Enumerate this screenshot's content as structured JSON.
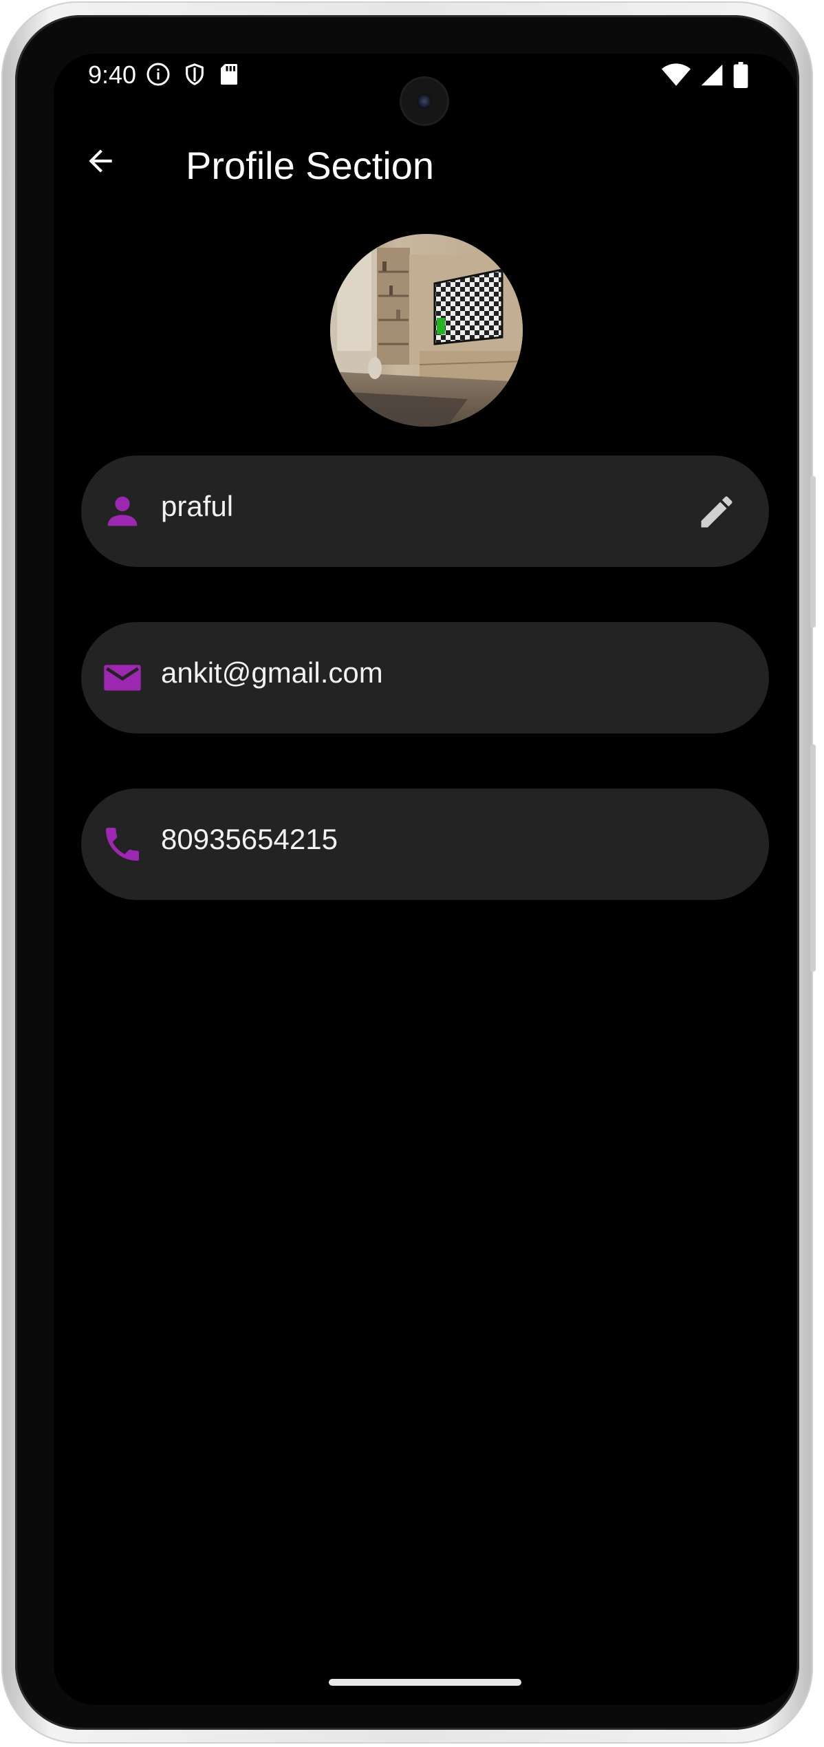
{
  "status_bar": {
    "time": "9:40",
    "left_icons": [
      "info-icon",
      "shield-icon",
      "sd-card-icon"
    ],
    "right_icons": [
      "wifi-icon",
      "signal-icon",
      "battery-icon"
    ]
  },
  "app_bar": {
    "title": "Profile Section",
    "back_icon": "arrow-left-icon"
  },
  "profile": {
    "avatar": "living-room-photo",
    "fields": [
      {
        "icon": "person-icon",
        "value": "praful",
        "editable": true,
        "action_icon": "pencil-icon"
      },
      {
        "icon": "mail-icon",
        "value": "ankit@gmail.com"
      },
      {
        "icon": "phone-icon",
        "value": "80935654215"
      }
    ]
  },
  "colors": {
    "background": "#000000",
    "field_background": "#232323",
    "accent": "#9c27b0",
    "text": "#f2f2f2"
  }
}
